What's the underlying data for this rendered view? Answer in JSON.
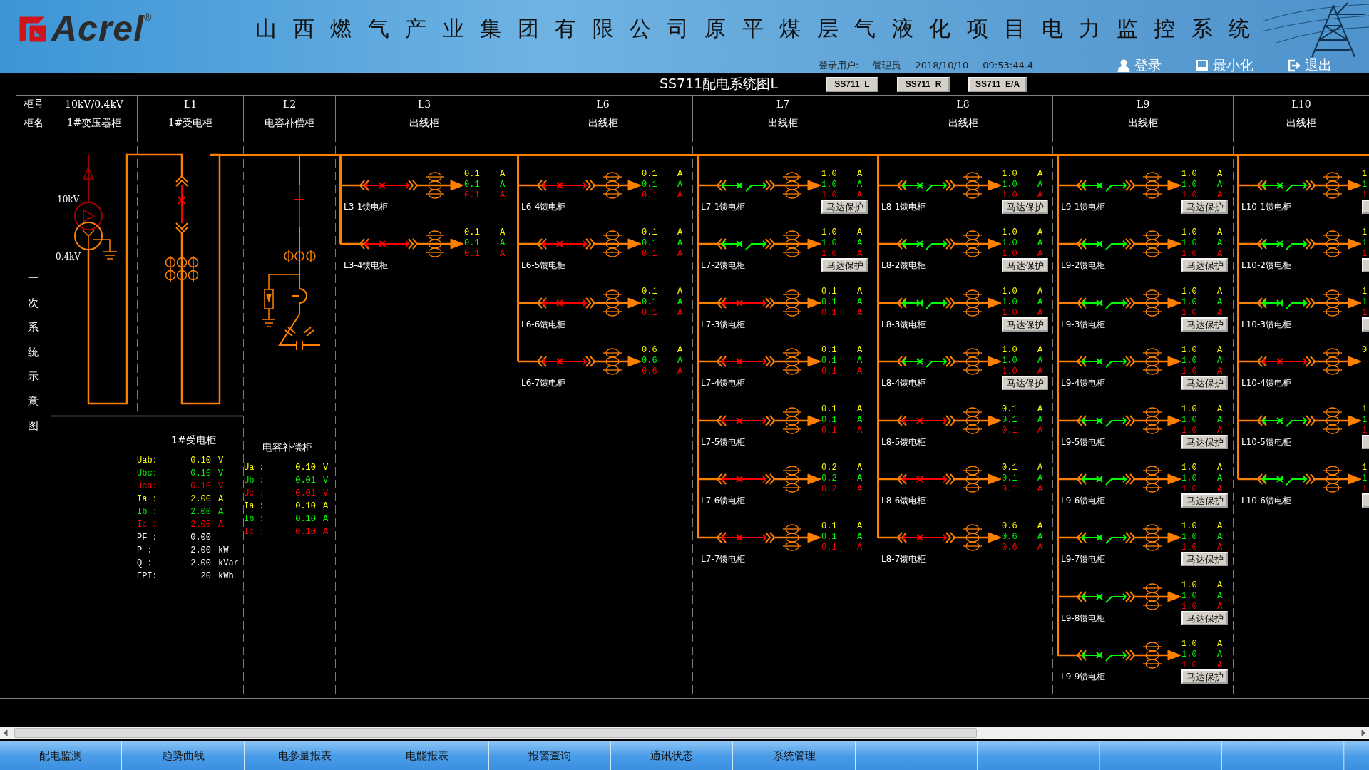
{
  "header": {
    "logo": {
      "text": "Acrel",
      "mark": "®"
    },
    "title": "山西燃气产业集团有限公司原平煤层气液化项目电力监控系统",
    "user_label": "登录用户:",
    "user": "管理员",
    "date": "2018/10/10",
    "time": "09:53:44.4",
    "actions": [
      {
        "kind": "login",
        "label": "登录"
      },
      {
        "kind": "minimize",
        "label": "最小化"
      },
      {
        "kind": "exit",
        "label": "退出"
      }
    ]
  },
  "view": {
    "title": "SS711配电系统图L",
    "buttons": [
      "SS711_L",
      "SS711_R",
      "SS711_E/A"
    ]
  },
  "cabinet_table": {
    "rows": [
      {
        "label": "柜号",
        "cells": [
          "10kV/0.4kV",
          "L1",
          "L2",
          "L3",
          "L6",
          "L7",
          "L8",
          "L9",
          "L10"
        ]
      },
      {
        "label": "柜名",
        "cells": [
          "1#变压器柜",
          "1#受电柜",
          "电容补偿柜",
          "出线柜",
          "出线柜",
          "出线柜",
          "出线柜",
          "出线柜",
          "出线柜"
        ]
      }
    ]
  },
  "diagram": {
    "side_label": "一次系统示意图",
    "transformer": {
      "hv_label": "10kV",
      "lv_label": "0.4kV"
    },
    "incomer": {
      "closed": false
    },
    "capacitor": {
      "closed": false
    },
    "panels": [
      {
        "title": "1#受电柜",
        "rows": [
          {
            "label": "Uab:",
            "value": "0.10",
            "unit": "V",
            "color": "#ffff00"
          },
          {
            "label": "Ubc:",
            "value": "0.10",
            "unit": "V",
            "color": "#00ff00"
          },
          {
            "label": "Uca:",
            "value": "0.10",
            "unit": "V",
            "color": "#ff0000"
          },
          {
            "label": "Ia :",
            "value": "2.00",
            "unit": "A",
            "color": "#ffff00"
          },
          {
            "label": "Ib :",
            "value": "2.00",
            "unit": "A",
            "color": "#00ff00"
          },
          {
            "label": "Ic :",
            "value": "2.00",
            "unit": "A",
            "color": "#ff0000"
          },
          {
            "label": "PF :",
            "value": "0.00",
            "color": "#ffffff"
          },
          {
            "label": "P  :",
            "value": "2.00",
            "unit": "kW",
            "color": "#ffffff"
          },
          {
            "label": "Q  :",
            "value": "2.00",
            "unit": "kVar",
            "color": "#ffffff"
          },
          {
            "label": "EPI:",
            "value": "20",
            "unit": "kWh",
            "color": "#ffffff"
          }
        ]
      },
      {
        "title": "电容补偿柜",
        "rows": [
          {
            "label": "Ua :",
            "value": "0.10",
            "unit": "V",
            "color": "#ffff00"
          },
          {
            "label": "Ub :",
            "value": "0.01",
            "unit": "V",
            "color": "#00ff00"
          },
          {
            "label": "Uc :",
            "value": "0.01",
            "unit": "V",
            "color": "#ff0000"
          },
          {
            "label": "Ia :",
            "value": "0.10",
            "unit": "A",
            "color": "#ffff00"
          },
          {
            "label": "Ib :",
            "value": "0.10",
            "unit": "A",
            "color": "#00ff00"
          },
          {
            "label": "Ic :",
            "value": "0.10",
            "unit": "A",
            "color": "#ff0000"
          }
        ]
      }
    ],
    "feeder_columns": [
      {
        "feeders": [
          {
            "name": "L3-1馈电柜",
            "closed": false,
            "protection": false,
            "readings": [
              {
                "value": "0.1",
                "unit": "A"
              },
              {
                "value": "0.1",
                "unit": "A"
              },
              {
                "value": "0.1",
                "unit": "A"
              }
            ]
          },
          {
            "name": "L3-4馈电柜",
            "closed": false,
            "protection": false,
            "readings": [
              {
                "value": "0.1",
                "unit": "A"
              },
              {
                "value": "0.1",
                "unit": "A"
              },
              {
                "value": "0.1",
                "unit": "A"
              }
            ]
          }
        ]
      },
      {
        "feeders": [
          {
            "name": "L6-4馈电柜",
            "closed": false,
            "protection": false,
            "readings": [
              {
                "value": "0.1",
                "unit": "A"
              },
              {
                "value": "0.1",
                "unit": "A"
              },
              {
                "value": "0.1",
                "unit": "A"
              }
            ]
          },
          {
            "name": "L6-5馈电柜",
            "closed": false,
            "protection": false,
            "readings": [
              {
                "value": "0.1",
                "unit": "A"
              },
              {
                "value": "0.1",
                "unit": "A"
              },
              {
                "value": "0.1",
                "unit": "A"
              }
            ]
          },
          {
            "name": "L6-6馈电柜",
            "closed": false,
            "protection": false,
            "readings": [
              {
                "value": "0.1",
                "unit": "A"
              },
              {
                "value": "0.1",
                "unit": "A"
              },
              {
                "value": "0.1",
                "unit": "A"
              }
            ]
          },
          {
            "name": "L6-7馈电柜",
            "closed": false,
            "protection": false,
            "readings": [
              {
                "value": "0.6",
                "unit": "A"
              },
              {
                "value": "0.6",
                "unit": "A"
              },
              {
                "value": "0.6",
                "unit": "A"
              }
            ]
          }
        ]
      },
      {
        "feeders": [
          {
            "name": "L7-1馈电柜",
            "closed": true,
            "protection": true,
            "button_label": "马达保护",
            "readings": [
              {
                "value": "1.0",
                "unit": "A"
              },
              {
                "value": "1.0",
                "unit": "A"
              },
              {
                "value": "1.0",
                "unit": "A"
              }
            ]
          },
          {
            "name": "L7-2馈电柜",
            "closed": true,
            "protection": true,
            "button_label": "马达保护",
            "readings": [
              {
                "value": "1.0",
                "unit": "A"
              },
              {
                "value": "1.0",
                "unit": "A"
              },
              {
                "value": "1.0",
                "unit": "A"
              }
            ]
          },
          {
            "name": "L7-3馈电柜",
            "closed": false,
            "protection": false,
            "readings": [
              {
                "value": "0.1",
                "unit": "A"
              },
              {
                "value": "0.1",
                "unit": "A"
              },
              {
                "value": "0.1",
                "unit": "A"
              }
            ]
          },
          {
            "name": "L7-4馈电柜",
            "closed": false,
            "protection": false,
            "readings": [
              {
                "value": "0.1",
                "unit": "A"
              },
              {
                "value": "0.1",
                "unit": "A"
              },
              {
                "value": "0.1",
                "unit": "A"
              }
            ]
          },
          {
            "name": "L7-5馈电柜",
            "closed": false,
            "protection": false,
            "readings": [
              {
                "value": "0.1",
                "unit": "A"
              },
              {
                "value": "0.1",
                "unit": "A"
              },
              {
                "value": "0.1",
                "unit": "A"
              }
            ]
          },
          {
            "name": "L7-6馈电柜",
            "closed": false,
            "protection": false,
            "readings": [
              {
                "value": "0.2",
                "unit": "A"
              },
              {
                "value": "0.2",
                "unit": "A"
              },
              {
                "value": "0.2",
                "unit": "A"
              }
            ]
          },
          {
            "name": "L7-7馈电柜",
            "closed": false,
            "protection": false,
            "readings": [
              {
                "value": "0.1",
                "unit": "A"
              },
              {
                "value": "0.1",
                "unit": "A"
              },
              {
                "value": "0.1",
                "unit": "A"
              }
            ]
          }
        ]
      },
      {
        "feeders": [
          {
            "name": "L8-1馈电柜",
            "closed": true,
            "protection": true,
            "button_label": "马达保护",
            "readings": [
              {
                "value": "1.0",
                "unit": "A"
              },
              {
                "value": "1.0",
                "unit": "A"
              },
              {
                "value": "1.0",
                "unit": "A"
              }
            ]
          },
          {
            "name": "L8-2馈电柜",
            "closed": true,
            "protection": true,
            "button_label": "马达保护",
            "readings": [
              {
                "value": "1.0",
                "unit": "A"
              },
              {
                "value": "1.0",
                "unit": "A"
              },
              {
                "value": "1.0",
                "unit": "A"
              }
            ]
          },
          {
            "name": "L8-3馈电柜",
            "closed": true,
            "protection": true,
            "button_label": "马达保护",
            "readings": [
              {
                "value": "1.0",
                "unit": "A"
              },
              {
                "value": "1.0",
                "unit": "A"
              },
              {
                "value": "1.0",
                "unit": "A"
              }
            ]
          },
          {
            "name": "L8-4馈电柜",
            "closed": true,
            "protection": true,
            "button_label": "马达保护",
            "readings": [
              {
                "value": "1.0",
                "unit": "A"
              },
              {
                "value": "1.0",
                "unit": "A"
              },
              {
                "value": "1.0",
                "unit": "A"
              }
            ]
          },
          {
            "name": "L8-5馈电柜",
            "closed": false,
            "protection": false,
            "readings": [
              {
                "value": "0.1",
                "unit": "A"
              },
              {
                "value": "0.1",
                "unit": "A"
              },
              {
                "value": "0.1",
                "unit": "A"
              }
            ]
          },
          {
            "name": "L8-6馈电柜",
            "closed": false,
            "protection": false,
            "readings": [
              {
                "value": "0.1",
                "unit": "A"
              },
              {
                "value": "0.1",
                "unit": "A"
              },
              {
                "value": "0.1",
                "unit": "A"
              }
            ]
          },
          {
            "name": "L8-7馈电柜",
            "closed": false,
            "protection": false,
            "readings": [
              {
                "value": "0.6",
                "unit": "A"
              },
              {
                "value": "0.6",
                "unit": "A"
              },
              {
                "value": "0.6",
                "unit": "A"
              }
            ]
          }
        ]
      },
      {
        "feeders": [
          {
            "name": "L9-1馈电柜",
            "closed": true,
            "protection": true,
            "button_label": "马达保护",
            "readings": [
              {
                "value": "1.0",
                "unit": "A"
              },
              {
                "value": "1.0",
                "unit": "A"
              },
              {
                "value": "1.0",
                "unit": "A"
              }
            ]
          },
          {
            "name": "L9-2馈电柜",
            "closed": true,
            "protection": true,
            "button_label": "马达保护",
            "readings": [
              {
                "value": "1.0",
                "unit": "A"
              },
              {
                "value": "1.0",
                "unit": "A"
              },
              {
                "value": "1.0",
                "unit": "A"
              }
            ]
          },
          {
            "name": "L9-3馈电柜",
            "closed": true,
            "protection": true,
            "button_label": "马达保护",
            "readings": [
              {
                "value": "1.0",
                "unit": "A"
              },
              {
                "value": "1.0",
                "unit": "A"
              },
              {
                "value": "1.0",
                "unit": "A"
              }
            ]
          },
          {
            "name": "L9-4馈电柜",
            "closed": true,
            "protection": true,
            "button_label": "马达保护",
            "readings": [
              {
                "value": "1.0",
                "unit": "A"
              },
              {
                "value": "1.0",
                "unit": "A"
              },
              {
                "value": "1.0",
                "unit": "A"
              }
            ]
          },
          {
            "name": "L9-5馈电柜",
            "closed": true,
            "protection": true,
            "button_label": "马达保护",
            "readings": [
              {
                "value": "1.0",
                "unit": "A"
              },
              {
                "value": "1.0",
                "unit": "A"
              },
              {
                "value": "1.0",
                "unit": "A"
              }
            ]
          },
          {
            "name": "L9-6馈电柜",
            "closed": true,
            "protection": true,
            "button_label": "马达保护",
            "readings": [
              {
                "value": "1.0",
                "unit": "A"
              },
              {
                "value": "1.0",
                "unit": "A"
              },
              {
                "value": "1.0",
                "unit": "A"
              }
            ]
          },
          {
            "name": "L9-7馈电柜",
            "closed": true,
            "protection": true,
            "button_label": "马达保护",
            "readings": [
              {
                "value": "1.0",
                "unit": "A"
              },
              {
                "value": "1.0",
                "unit": "A"
              },
              {
                "value": "1.0",
                "unit": "A"
              }
            ]
          },
          {
            "name": "L9-8馈电柜",
            "closed": true,
            "protection": true,
            "button_label": "马达保护",
            "readings": [
              {
                "value": "1.0",
                "unit": "A"
              },
              {
                "value": "1.0",
                "unit": "A"
              },
              {
                "value": "1.0",
                "unit": "A"
              }
            ]
          },
          {
            "name": "L9-9馈电柜",
            "closed": true,
            "protection": true,
            "button_label": "马达保护",
            "readings": [
              {
                "value": "1.0",
                "unit": "A"
              },
              {
                "value": "1.0",
                "unit": "A"
              },
              {
                "value": "1.0",
                "unit": "A"
              }
            ]
          }
        ]
      },
      {
        "feeders": [
          {
            "name": "L10-1馈电柜",
            "closed": true,
            "protection": true,
            "readings": [
              {
                "value": "1"
              },
              {
                "value": "1"
              },
              {
                "value": "1"
              }
            ]
          },
          {
            "name": "L10-2馈电柜",
            "closed": true,
            "protection": true,
            "readings": [
              {
                "value": "1"
              },
              {
                "value": "1"
              },
              {
                "value": "1"
              }
            ]
          },
          {
            "name": "L10-3馈电柜",
            "closed": true,
            "protection": true,
            "readings": [
              {
                "value": "1"
              },
              {
                "value": "1"
              },
              {
                "value": "1"
              }
            ]
          },
          {
            "name": "L10-4馈电柜",
            "closed": false,
            "protection": false,
            "readings": [
              {
                "value": "0"
              }
            ]
          },
          {
            "name": "L10-5馈电柜",
            "closed": true,
            "protection": true,
            "readings": [
              {
                "value": "1"
              },
              {
                "value": "1"
              },
              {
                "value": "1"
              }
            ]
          },
          {
            "name": "L10-6馈电柜",
            "closed": true,
            "protection": true,
            "readings": [
              {
                "value": "1"
              },
              {
                "value": "1"
              },
              {
                "value": "1"
              }
            ]
          }
        ]
      }
    ]
  },
  "nav": {
    "items": [
      "配电监测",
      "趋势曲线",
      "电参量报表",
      "电能报表",
      "报警查询",
      "通讯状态",
      "系统管理"
    ]
  }
}
